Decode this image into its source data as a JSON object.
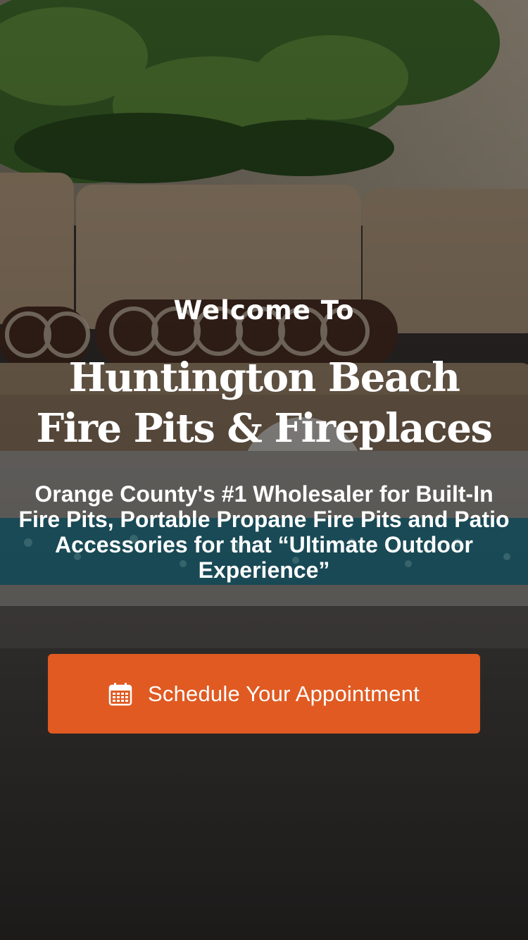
{
  "hero": {
    "welcome": "Welcome To",
    "title_line1": "Huntington Beach",
    "title_line2": "Fire Pits & Fireplaces",
    "subtitle": "Orange County's #1 Wholesaler for Built-In Fire Pits, Portable Propane Fire Pits and Patio Accessories for that “Ultimate Outdoor Experience”",
    "cta_label": "Schedule Your Appointment",
    "cta_icon": "calendar-icon"
  },
  "colors": {
    "cta_background": "#e05a22",
    "text": "#ffffff"
  }
}
